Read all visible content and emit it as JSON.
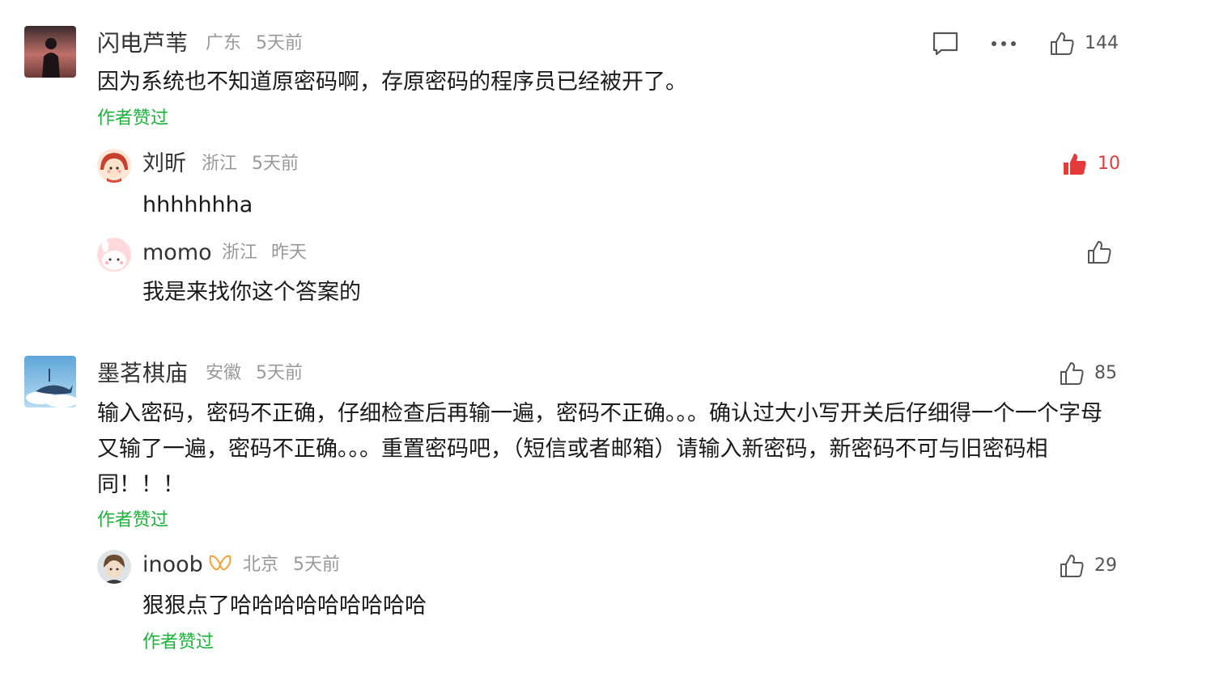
{
  "colors": {
    "accent_green": "#1ab23a",
    "like_red": "#e33a3a",
    "meta_gray": "#999999"
  },
  "comments": [
    {
      "username": "闪电芦苇",
      "location": "广东",
      "time": "5天前",
      "text": "因为系统也不知道原密码啊，存原密码的程序员已经被开了。",
      "author_liked": "作者赞过",
      "likes": "144",
      "liked": false,
      "actions": [
        "reply-icon",
        "more-icon",
        "thumb-up-icon"
      ],
      "replies": [
        {
          "username": "刘昕",
          "location": "浙江",
          "time": "5天前",
          "text": "hhhhhhha",
          "likes": "10",
          "liked": true
        },
        {
          "username": "momo",
          "location": "浙江",
          "time": "昨天",
          "text": "我是来找你这个答案的",
          "likes": "",
          "liked": false
        }
      ]
    },
    {
      "username": "墨茗棋庙",
      "location": "安徽",
      "time": "5天前",
      "text": "输入密码，密码不正确，仔细检查后再输一遍，密码不正确。。。确认过大小写开关后仔细得一个一个字母又输了一遍，密码不正确。。。重置密码吧，（短信或者邮箱）请输入新密码，新密码不可与旧密码相同！！！",
      "author_liked": "作者赞过",
      "likes": "85",
      "liked": false,
      "replies": [
        {
          "username": "inoob",
          "badge": "butterfly-badge-icon",
          "location": "北京",
          "time": "5天前",
          "text": "狠狠点了哈哈哈哈哈哈哈哈哈",
          "author_liked": "作者赞过",
          "likes": "29",
          "liked": false
        }
      ]
    }
  ]
}
